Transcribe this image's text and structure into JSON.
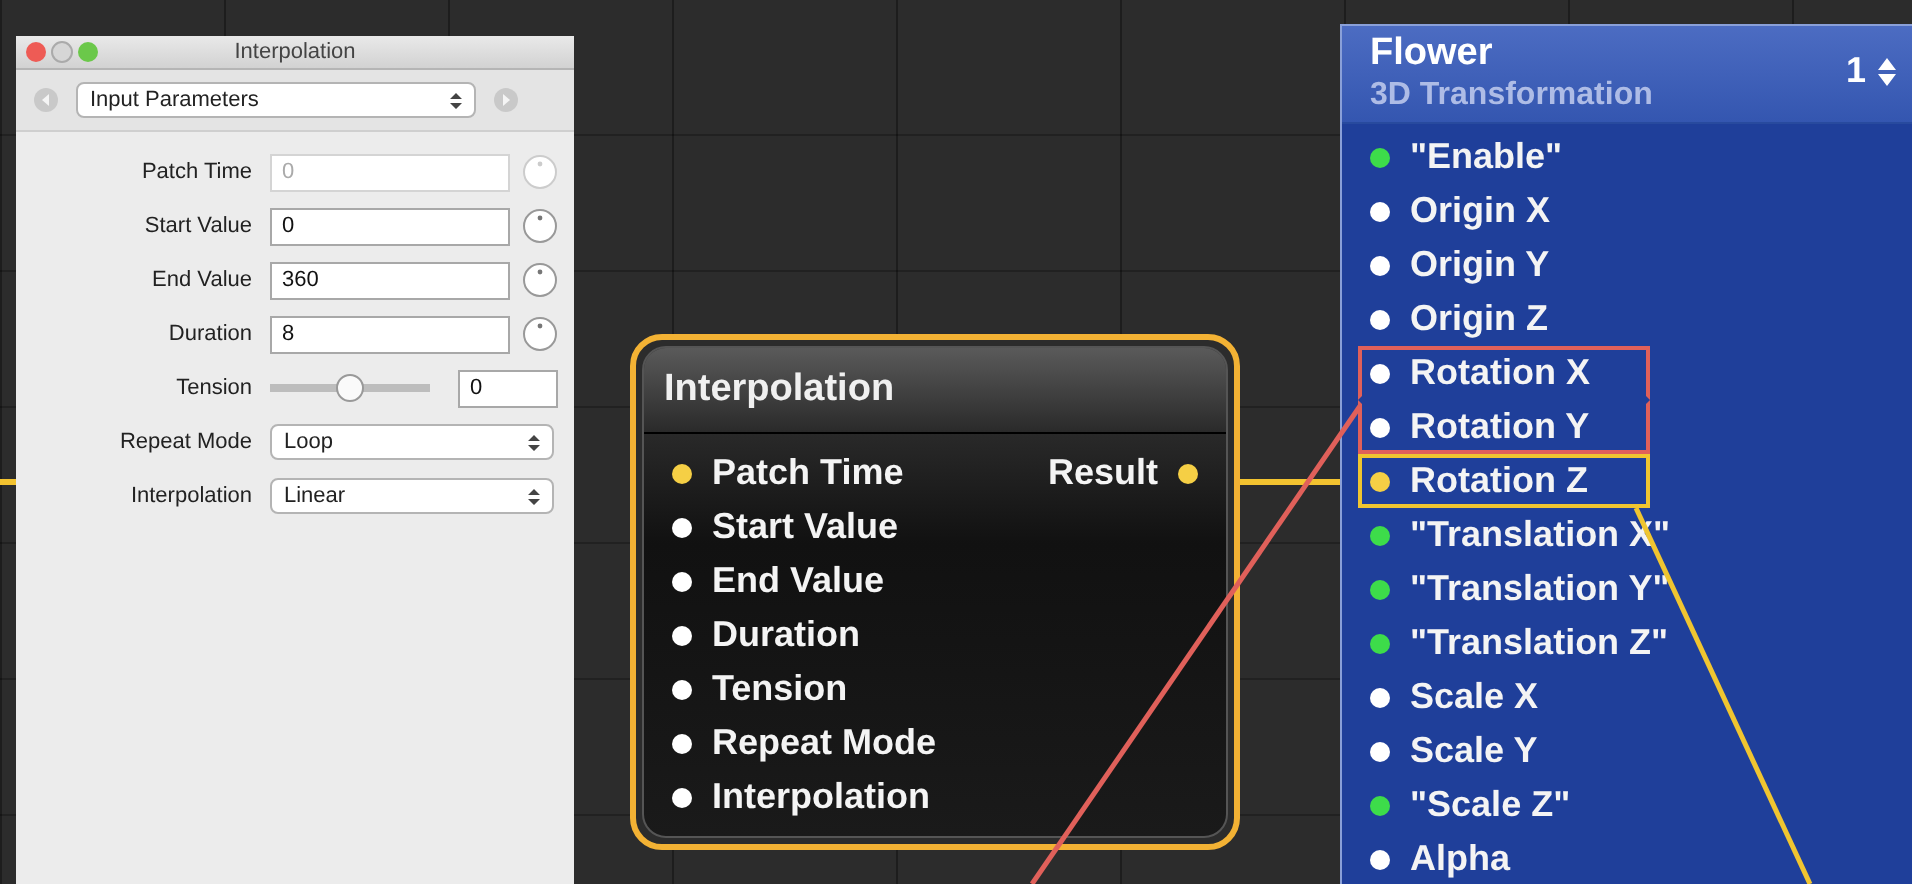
{
  "inspector": {
    "title": "Interpolation",
    "section": "Input Parameters",
    "rows": [
      {
        "kind": "field",
        "label": "Patch Time",
        "value": "0",
        "disabled": true
      },
      {
        "kind": "field",
        "label": "Start Value",
        "value": "0",
        "disabled": false
      },
      {
        "kind": "field",
        "label": "End Value",
        "value": "360",
        "disabled": false
      },
      {
        "kind": "field",
        "label": "Duration",
        "value": "8",
        "disabled": false
      },
      {
        "kind": "slider",
        "label": "Tension",
        "level": 0.5,
        "value": "0"
      },
      {
        "kind": "select",
        "label": "Repeat Mode",
        "value": "Loop"
      },
      {
        "kind": "select",
        "label": "Interpolation",
        "value": "Linear"
      }
    ]
  },
  "interpolation_node": {
    "title": "Interpolation",
    "inputs": [
      {
        "label": "Patch Time",
        "color": "#f5cf45"
      },
      {
        "label": "Start Value",
        "color": "#ffffff"
      },
      {
        "label": "End Value",
        "color": "#ffffff"
      },
      {
        "label": "Duration",
        "color": "#ffffff"
      },
      {
        "label": "Tension",
        "color": "#ffffff"
      },
      {
        "label": "Repeat Mode",
        "color": "#ffffff"
      },
      {
        "label": "Interpolation",
        "color": "#ffffff"
      }
    ],
    "outputs": [
      {
        "label": "Result",
        "color": "#f5cf45"
      }
    ]
  },
  "flower_node": {
    "title": "Flower",
    "subtitle": "3D Transformation",
    "count": "1",
    "ports": [
      {
        "label": "\"Enable\"",
        "color": "#3ddc4a"
      },
      {
        "label": "Origin X",
        "color": "#ffffff"
      },
      {
        "label": "Origin Y",
        "color": "#ffffff"
      },
      {
        "label": "Origin Z",
        "color": "#ffffff"
      },
      {
        "label": "Rotation X",
        "color": "#ffffff",
        "red_frame": true
      },
      {
        "label": "Rotation Y",
        "color": "#ffffff",
        "red_frame": true
      },
      {
        "label": "Rotation Z",
        "color": "#f5cf45",
        "yellow_frame": true
      },
      {
        "label": "\"Translation X\"",
        "color": "#3ddc4a"
      },
      {
        "label": "\"Translation Y\"",
        "color": "#3ddc4a"
      },
      {
        "label": "\"Translation Z\"",
        "color": "#3ddc4a"
      },
      {
        "label": "Scale X",
        "color": "#ffffff"
      },
      {
        "label": "Scale Y",
        "color": "#ffffff"
      },
      {
        "label": "\"Scale Z\"",
        "color": "#3ddc4a"
      },
      {
        "label": "Alpha",
        "color": "#ffffff"
      }
    ]
  }
}
